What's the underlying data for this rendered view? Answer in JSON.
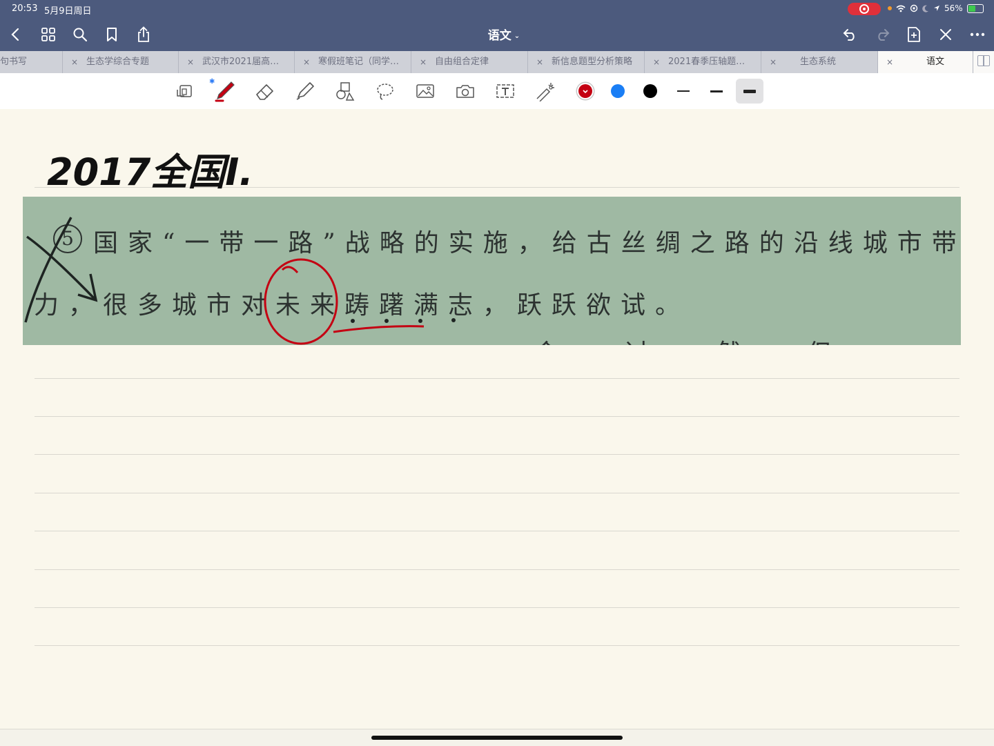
{
  "status_bar": {
    "time": "20:53",
    "date": "5月9日周日",
    "battery": "56%",
    "battery_level": 0.56
  },
  "toolbar": {
    "title": "语文",
    "title_chevron": "⌄"
  },
  "tabs": [
    {
      "label": "句书写",
      "active": false
    },
    {
      "label": "生态学综合专题",
      "active": false
    },
    {
      "label": "武汉市2021届高…",
      "active": false
    },
    {
      "label": "寒假班笔记（同学…",
      "active": false
    },
    {
      "label": "自由组合定律",
      "active": false
    },
    {
      "label": "新信息题型分析策略",
      "active": false
    },
    {
      "label": "2021春季压轴题…",
      "active": false
    },
    {
      "label": "生态系统",
      "active": false
    },
    {
      "label": "语文",
      "active": true
    }
  ],
  "tab_close": "×",
  "colors": {
    "chrome": "#4c5a7d",
    "pen_red": "#c40012",
    "pen_blue": "#1a7ef5",
    "pen_black": "#000000",
    "paper": "#faf7ec"
  },
  "tools": [
    "page-layout-icon",
    "pen-icon",
    "eraser-icon",
    "highlighter-icon",
    "shapes-icon",
    "lasso-icon",
    "image-icon",
    "camera-icon",
    "text-box-icon",
    "laser-pointer-icon"
  ],
  "note": {
    "handwritten_title": "2017全国Ⅰ.",
    "photo_line1_number": "5",
    "photo_line1": "国家“一带一路”战略的实施，给古丝绸之路的沿线城市带来了活",
    "photo_line2": "力，很多城市对未来踌躇满志，跃跃欲试。",
    "photo_line3": "令：过：然：但：也：在：大"
  }
}
